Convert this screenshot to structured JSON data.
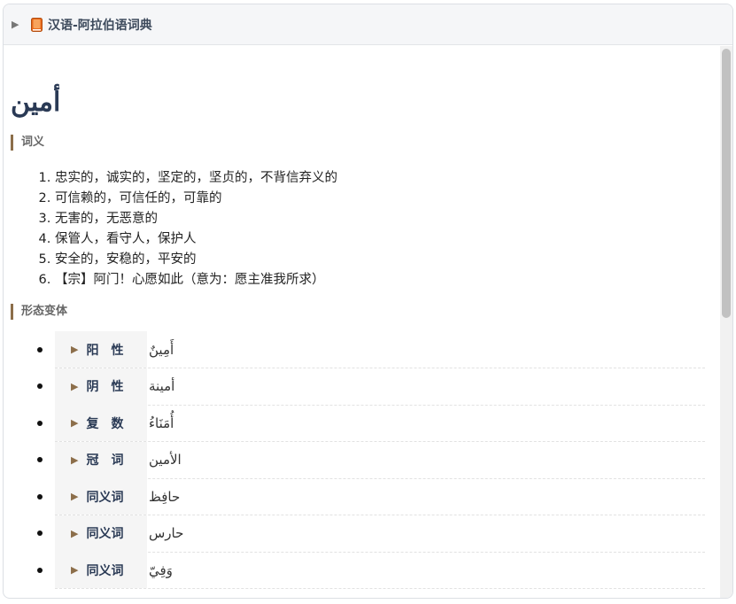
{
  "header": {
    "title": "汉语-阿拉伯语词典",
    "toggle_icon": "triangle-right",
    "book_icon": "book-icon",
    "book_color": "#e8691c"
  },
  "entry": {
    "headword": "أمين"
  },
  "sections": {
    "senses_title": "词义",
    "forms_title": "形态变体"
  },
  "senses": [
    "忠实的，诚实的，坚定的，坚贞的，不背信弃义的",
    "可信赖的，可信任的，可靠的",
    "无害的，无恶意的",
    "保管人，看守人，保护人",
    "安全的，安稳的，平安的",
    "【宗】阿门！心愿如此（意为：愿主准我所求）"
  ],
  "forms": [
    {
      "label": "阳性",
      "value": "أَمِينٌ"
    },
    {
      "label": "阴性",
      "value": "أمينة"
    },
    {
      "label": "复数",
      "value": "أُمَنَاءُ"
    },
    {
      "label": "冠词",
      "value": "الأمين"
    },
    {
      "label": "同义词",
      "value": "حافِظ"
    },
    {
      "label": "同义词",
      "value": "حارس"
    },
    {
      "label": "同义词",
      "value": "وَفِيّ"
    }
  ],
  "colors": {
    "accent": "#8c6e4a",
    "title": "#2a3a55"
  }
}
